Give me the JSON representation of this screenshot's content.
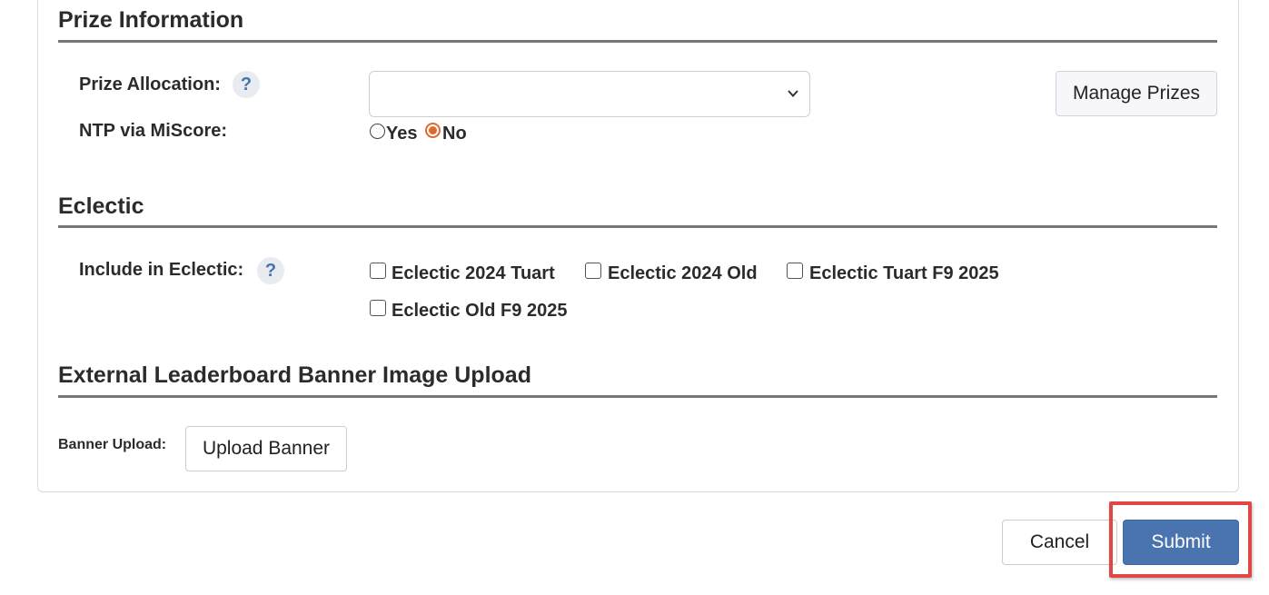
{
  "sections": {
    "prize": {
      "title": "Prize Information"
    },
    "eclectic": {
      "title": "Eclectic"
    },
    "banner": {
      "title": "External Leaderboard Banner Image Upload"
    }
  },
  "prize": {
    "allocation_label": "Prize Allocation:",
    "allocation_value": "",
    "help_glyph": "?",
    "manage_button": "Manage Prizes",
    "ntp_label": "NTP via MiScore:",
    "ntp_options": [
      {
        "label": "Yes",
        "checked": false
      },
      {
        "label": "No",
        "checked": true
      }
    ]
  },
  "eclectic": {
    "include_label": "Include in Eclectic:",
    "help_glyph": "?",
    "options": [
      {
        "label": "Eclectic 2024 Tuart",
        "checked": false
      },
      {
        "label": "Eclectic 2024 Old",
        "checked": false
      },
      {
        "label": "Eclectic Tuart F9 2025",
        "checked": false
      },
      {
        "label": "Eclectic Old F9 2025",
        "checked": false
      }
    ]
  },
  "banner": {
    "upload_label": "Banner Upload:",
    "upload_button": "Upload Banner"
  },
  "footer": {
    "cancel_button": "Cancel",
    "submit_button": "Submit"
  },
  "colors": {
    "primary": "#4a74b0",
    "radio_accent": "#e06a2b",
    "highlight": "#e04848"
  },
  "icons": {
    "select_arrow": "chevron-down-icon",
    "help": "help-icon"
  }
}
